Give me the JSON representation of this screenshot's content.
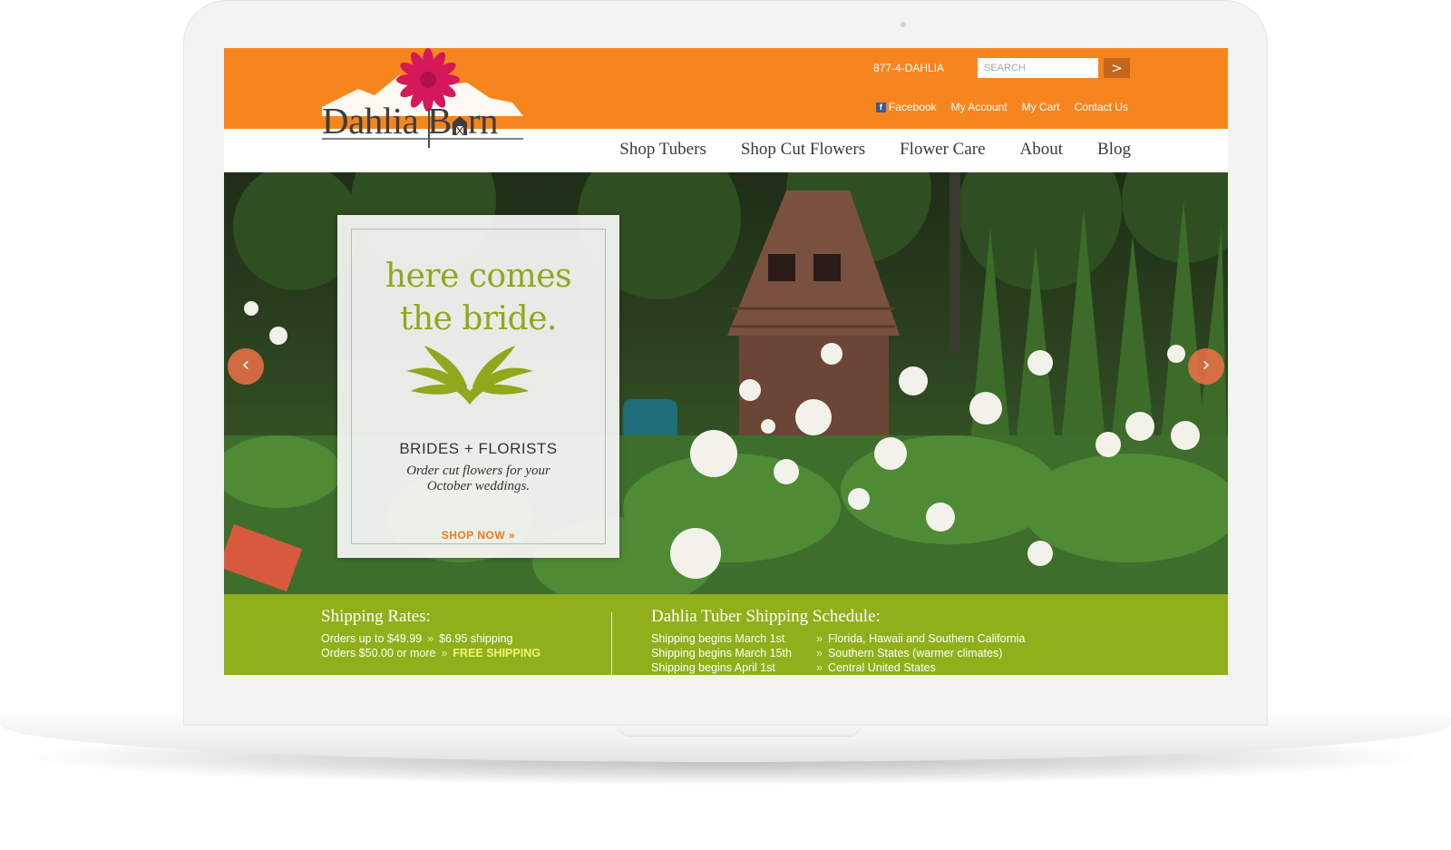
{
  "header": {
    "phone": "877-4-DAHLIA",
    "search_placeholder": "SEARCH",
    "search_button": ">",
    "links": [
      "Facebook",
      "My Account",
      "My Cart",
      "Contact Us"
    ],
    "facebook_icon": "facebook-icon"
  },
  "logo": {
    "part1": "Dahlia B",
    "part2": "rn"
  },
  "nav": [
    "Shop Tubers",
    "Shop Cut Flowers",
    "Flower Care",
    "About",
    "Blog"
  ],
  "hero": {
    "headline_line1": "here comes",
    "headline_line2": "the bride.",
    "subtitle": "BRIDES + FLORISTS",
    "description": "Order cut flowers for your October weddings.",
    "cta": "SHOP NOW »",
    "prev_arrow": "‹",
    "next_arrow": "›"
  },
  "shipping": {
    "rates_title": "Shipping Rates:",
    "rates": [
      {
        "label": "Orders up to $49.99",
        "value": "$6.95 shipping"
      },
      {
        "label": "Orders $50.00 or more",
        "value": "FREE SHIPPING"
      }
    ],
    "schedule_title": "Dahlia Tuber Shipping Schedule:",
    "schedule": [
      {
        "date": "Shipping begins March 1st",
        "region": "Florida, Hawaii and Southern California"
      },
      {
        "date": "Shipping begins March 15th",
        "region": "Southern States (warmer climates)"
      },
      {
        "date": "Shipping begins April 1st",
        "region": "Central United States"
      }
    ],
    "separator": "»"
  },
  "colors": {
    "header_orange": "#f7851d",
    "accent_green": "#8fb01b",
    "headline_green": "#8ea91b",
    "cta_orange": "#f07a1a",
    "free_shipping_yellow": "#f2f56e"
  }
}
